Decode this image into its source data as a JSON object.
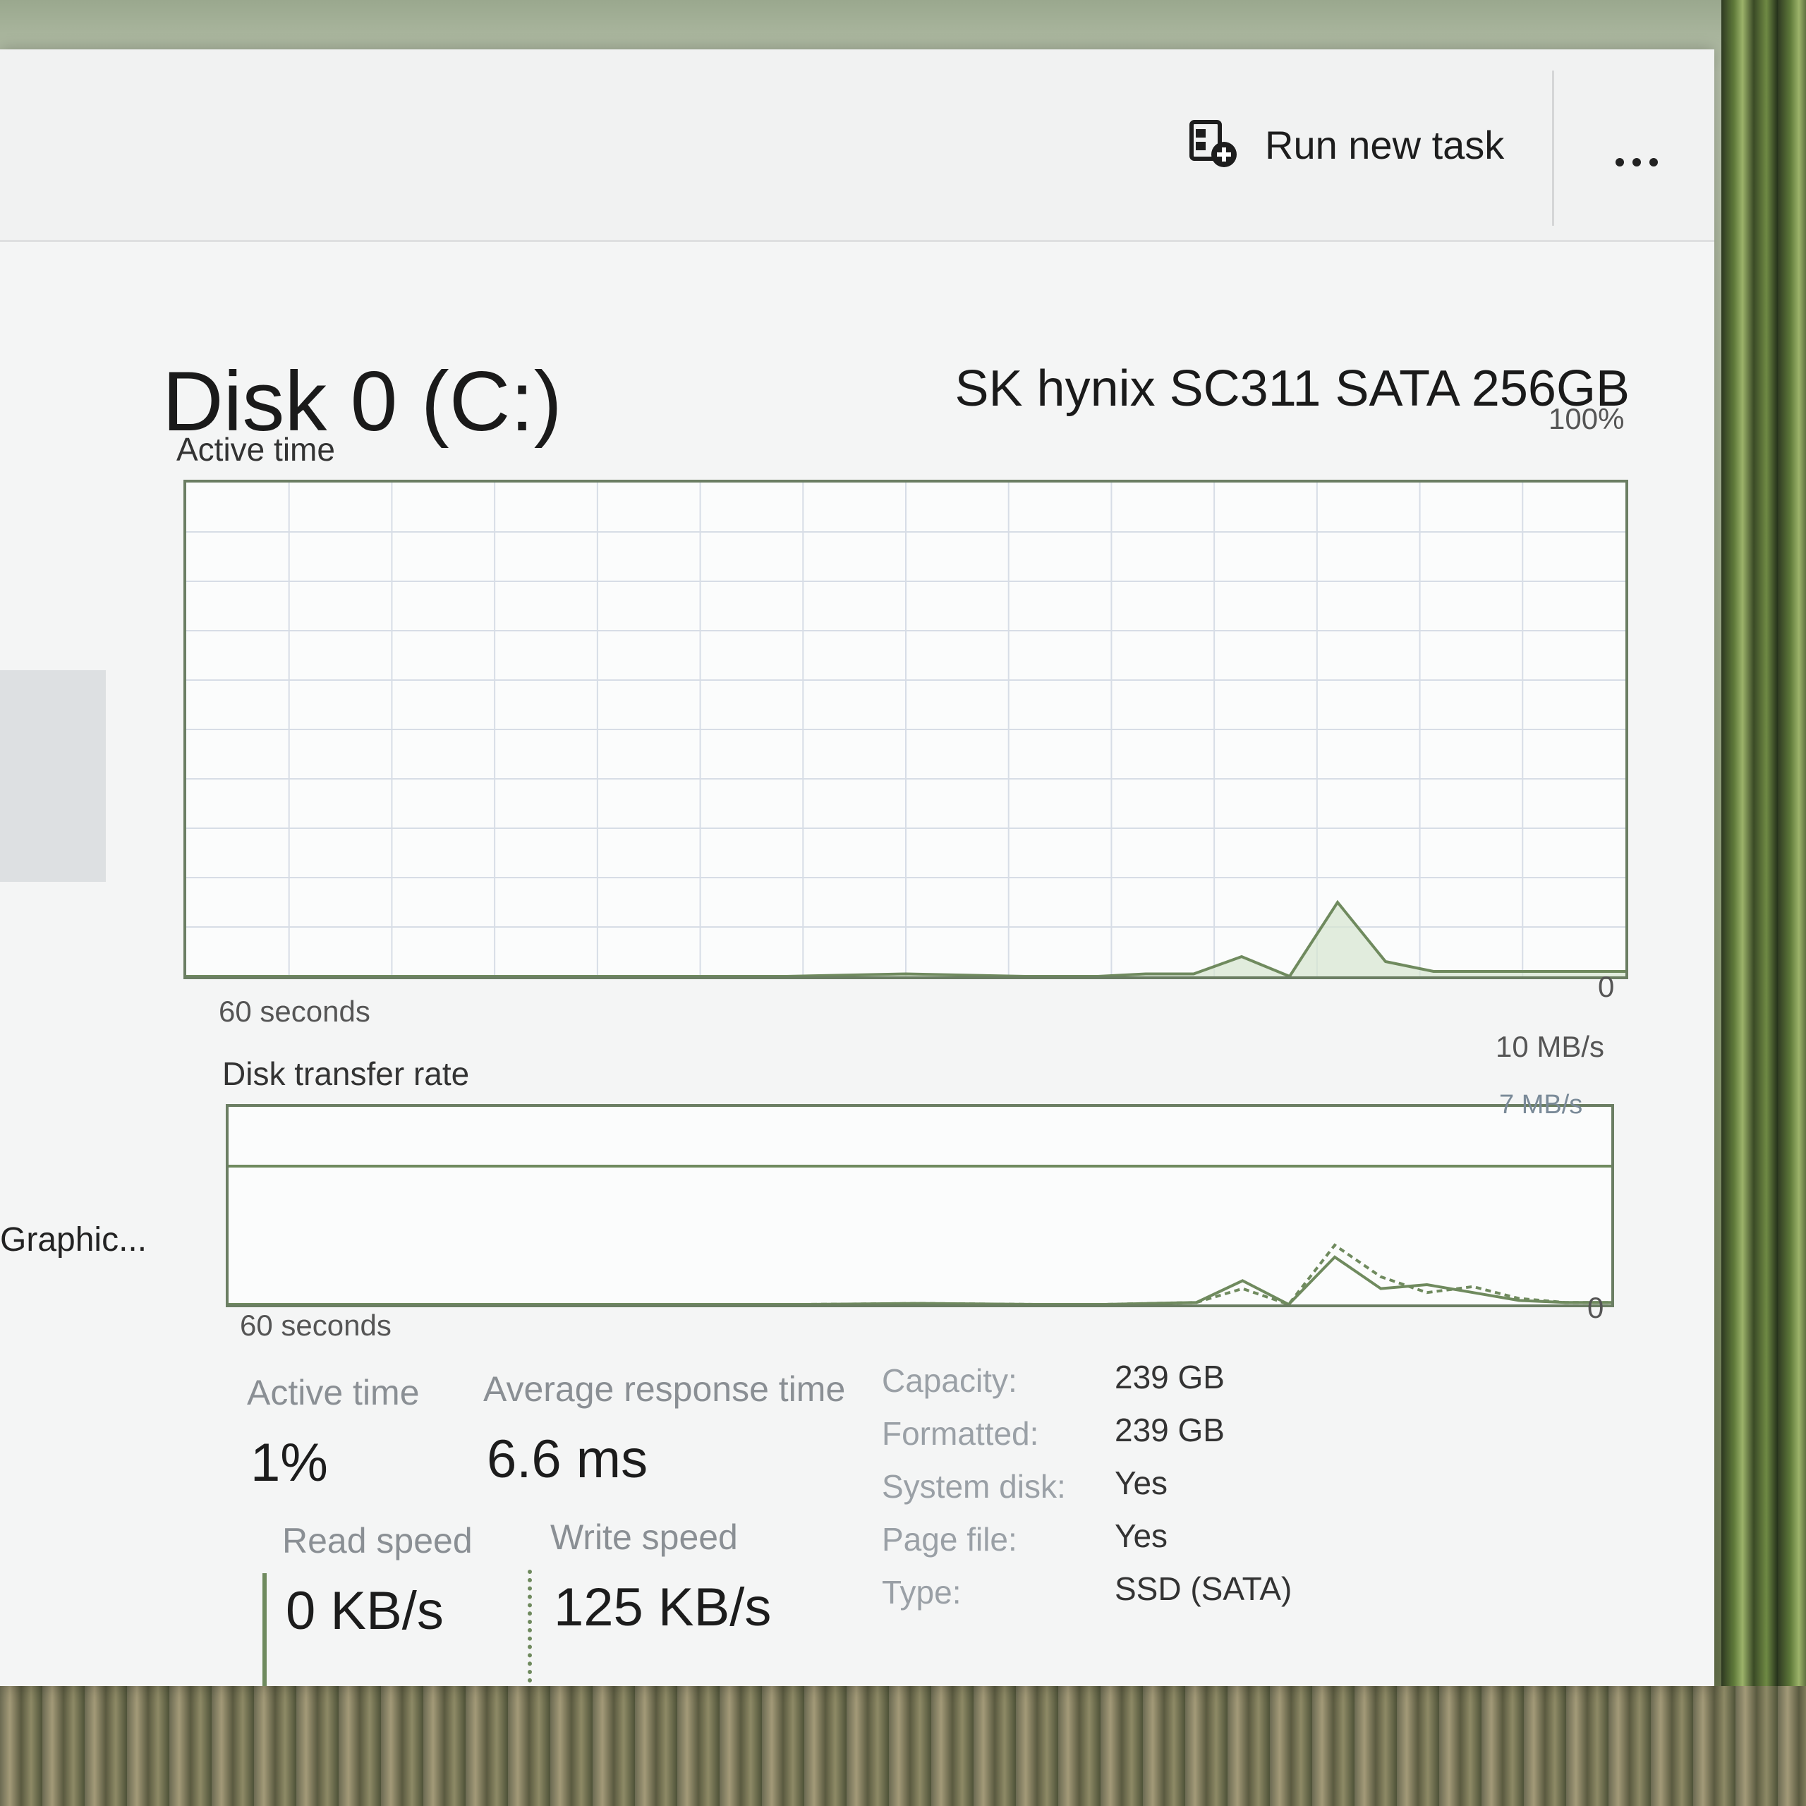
{
  "toolbar": {
    "run_new_task_label": "Run new task",
    "more_icon": "more-horizontal-icon",
    "run_task_icon": "new-task-icon"
  },
  "sidebar": {
    "partial_item_label": "Graphic..."
  },
  "disk": {
    "title": "Disk 0 (C:)",
    "model": "SK hynix SC311 SATA 256GB"
  },
  "active_time_chart": {
    "label": "Active time",
    "max_label": "100%",
    "min_label": "0",
    "time_label": "60 seconds"
  },
  "transfer_chart": {
    "label": "Disk transfer rate",
    "max_label": "10 MB/s",
    "line_label": "7 MB/s",
    "min_label": "0",
    "time_label": "60 seconds"
  },
  "stats": {
    "active_time_label": "Active time",
    "active_time_value": "1%",
    "avg_response_label": "Average response time",
    "avg_response_value": "6.6 ms",
    "read_speed_label": "Read speed",
    "read_speed_value": "0 KB/s",
    "write_speed_label": "Write speed",
    "write_speed_value": "125 KB/s"
  },
  "properties": [
    {
      "label": "Capacity:",
      "value": "239 GB"
    },
    {
      "label": "Formatted:",
      "value": "239 GB"
    },
    {
      "label": "System disk:",
      "value": "Yes"
    },
    {
      "label": "Page file:",
      "value": "Yes"
    },
    {
      "label": "Type:",
      "value": "SSD (SATA)"
    }
  ],
  "colors": {
    "accent": "#6f8a5e",
    "chart_fill": "#d6e6d0"
  },
  "chart_data": [
    {
      "type": "area",
      "title": "Active time",
      "xlabel": "60 seconds",
      "ylim": [
        0,
        100
      ],
      "x": [
        0,
        5,
        10,
        15,
        20,
        25,
        30,
        35,
        38,
        40,
        42,
        44,
        46,
        48,
        50,
        52,
        54,
        56,
        58,
        60
      ],
      "values": [
        0,
        0,
        0,
        0,
        0,
        0,
        0.5,
        0,
        0,
        0.5,
        0.5,
        4,
        0,
        15,
        3,
        1,
        1,
        1,
        1,
        1
      ]
    },
    {
      "type": "line",
      "title": "Disk transfer rate",
      "xlabel": "60 seconds",
      "ylim": [
        0,
        10
      ],
      "x": [
        0,
        5,
        10,
        15,
        20,
        25,
        30,
        35,
        38,
        40,
        42,
        44,
        46,
        48,
        50,
        52,
        54,
        56,
        58,
        60
      ],
      "series": [
        {
          "values": [
            0,
            0,
            0,
            0,
            0,
            0,
            0.05,
            0,
            0,
            0.05,
            0.1,
            1.2,
            0,
            2.4,
            0.8,
            1.0,
            0.6,
            0.2,
            0.1,
            0.1
          ]
        },
        {
          "values": [
            0,
            0,
            0,
            0,
            0,
            0,
            0.05,
            0,
            0,
            0.05,
            0.1,
            0.8,
            0,
            3.0,
            1.4,
            0.6,
            0.9,
            0.3,
            0.1,
            0.1
          ]
        }
      ],
      "reference_line": 7
    }
  ]
}
